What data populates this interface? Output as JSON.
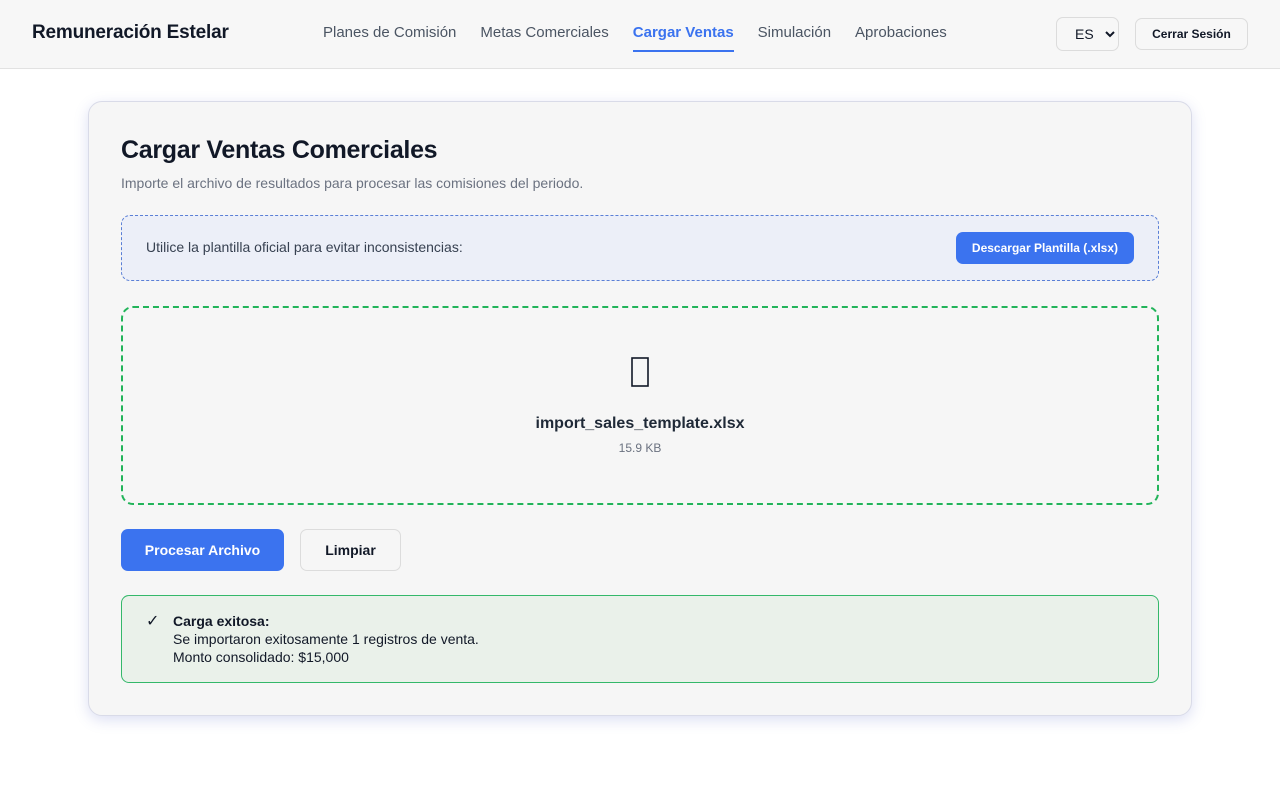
{
  "app": {
    "title": "Remuneración Estelar"
  },
  "nav": {
    "items": [
      {
        "label": "Planes de Comisión",
        "active": false
      },
      {
        "label": "Metas Comerciales",
        "active": false
      },
      {
        "label": "Cargar Ventas",
        "active": true
      },
      {
        "label": "Simulación",
        "active": false
      },
      {
        "label": "Aprobaciones",
        "active": false
      }
    ]
  },
  "header": {
    "language": {
      "selected": "ES",
      "options": [
        "ES"
      ]
    },
    "logout_label": "Cerrar Sesión"
  },
  "page": {
    "title": "Cargar Ventas Comerciales",
    "subtitle": "Importe el archivo de resultados para procesar las comisiones del periodo."
  },
  "template": {
    "text": "Utilice la plantilla oficial para evitar inconsistencias:",
    "download_label": "Descargar Plantilla (.xlsx)"
  },
  "upload": {
    "icon": "file-icon",
    "file_name": "import_sales_template.xlsx",
    "file_size": "15.9 KB"
  },
  "actions": {
    "process_label": "Procesar Archivo",
    "clear_label": "Limpiar"
  },
  "result": {
    "icon": "✓",
    "title": "Carga exitosa:",
    "line1": "Se importaron exitosamente 1 registros de venta.",
    "line2": "Monto consolidado: $15,000"
  },
  "colors": {
    "accent": "#3b73ef",
    "success_border": "#34b86a",
    "success_bg": "#eaf1ea",
    "dropzone_border": "#22b45a"
  }
}
